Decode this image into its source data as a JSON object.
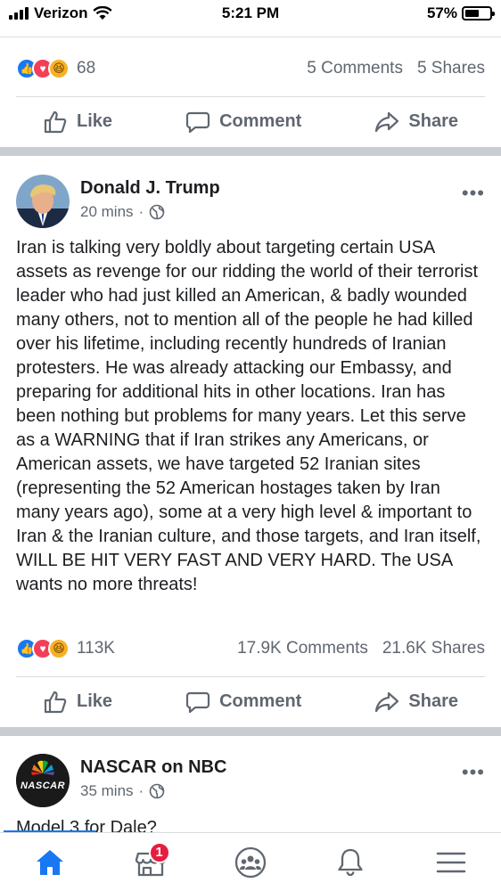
{
  "status": {
    "carrier": "Verizon",
    "time": "5:21 PM",
    "battery": "57%",
    "battery_fraction": 0.57
  },
  "prev_post": {
    "reactions_count": "68",
    "comments": "5 Comments",
    "shares": "5 Shares"
  },
  "actions": {
    "like": "Like",
    "comment": "Comment",
    "share": "Share"
  },
  "post1": {
    "author": "Donald J. Trump",
    "time": "20 mins",
    "separator": "·",
    "more": "•••",
    "text": "Iran is talking very boldly about targeting certain USA assets as revenge for our ridding the world of their terrorist leader who had just killed an American, & badly wounded many others, not to mention all of the people he had killed over his lifetime, including recently hundreds of Iranian protesters. He was already attacking our Embassy, and preparing for additional hits in other locations. Iran has been nothing but problems for many years. Let this serve as a WARNING that if Iran strikes any Americans, or American assets, we have targeted 52 Iranian sites (representing the 52 American hostages taken by Iran many years ago), some at a very high level & important to Iran &  the Iranian culture, and those targets, and Iran itself, WILL BE HIT VERY FAST AND VERY HARD. The USA wants no more threats!",
    "reactions_count": "113K",
    "comments": "17.9K Comments",
    "shares": "21.6K Shares"
  },
  "post2": {
    "author": "NASCAR on NBC",
    "avatar_text": "NASCAR",
    "time": "35 mins",
    "separator": "·",
    "more": "•••",
    "text": "Model 3 for Dale?"
  },
  "nav": {
    "marketplace_badge": "1"
  },
  "colors": {
    "accent": "#1877f2",
    "badge": "#e41e3f",
    "love": "#f33e58",
    "haha": "#f7b125"
  }
}
